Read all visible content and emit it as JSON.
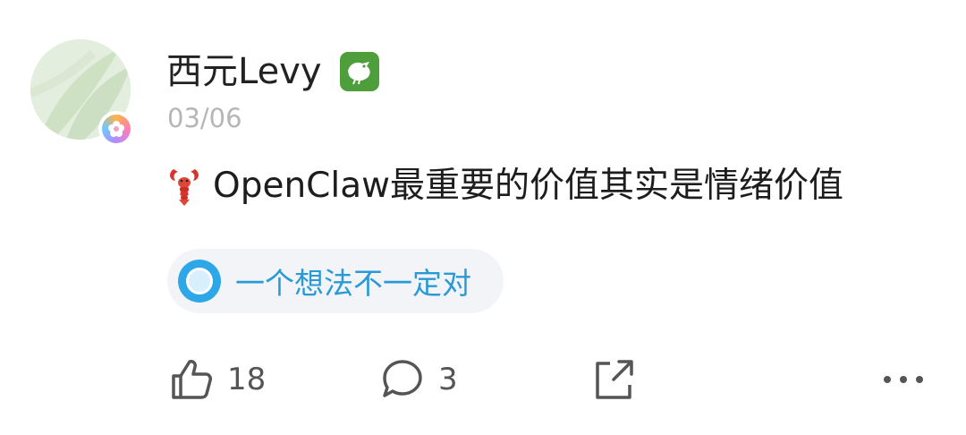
{
  "post": {
    "author": {
      "name": "西元Levy",
      "date": "03/06",
      "avatar_icon": "green-leaf-avatar",
      "avatar_badge_icon": "flower-badge-icon",
      "level_badge_icon": "bird-badge-icon"
    },
    "content": {
      "emoji_icon": "lobster-icon",
      "text": "OpenClaw最重要的价值其实是情绪价值"
    },
    "topic": {
      "label": "一个想法不一定对",
      "accent": "#2ea7e8"
    },
    "actions": {
      "like_count": "18",
      "comment_count": "3",
      "share_icon": "share-icon",
      "more_icon": "more-icon"
    }
  }
}
